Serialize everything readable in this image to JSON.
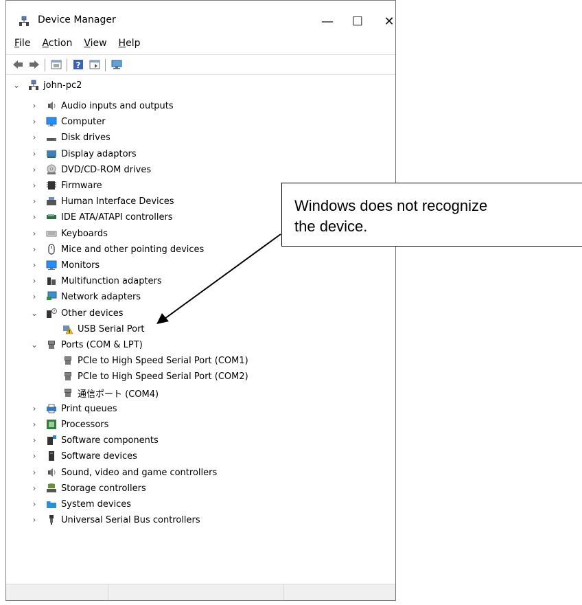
{
  "window": {
    "title": "Device Manager",
    "minimize": "—",
    "maximize": "☐",
    "close": "✕"
  },
  "menu": [
    {
      "underline": "F",
      "rest": "ile"
    },
    {
      "underline": "A",
      "rest": "ction"
    },
    {
      "underline": "V",
      "rest": "iew"
    },
    {
      "underline": "H",
      "rest": "elp"
    }
  ],
  "tree": {
    "root": "john-pc2",
    "categories": [
      {
        "label": "Audio inputs and outputs",
        "icon": "speaker-icon"
      },
      {
        "label": "Computer",
        "icon": "monitor-icon"
      },
      {
        "label": "Disk drives",
        "icon": "disk-icon"
      },
      {
        "label": "Display adaptors",
        "icon": "display-adapter-icon"
      },
      {
        "label": "DVD/CD-ROM drives",
        "icon": "dvd-icon"
      },
      {
        "label": "Firmware",
        "icon": "chip-icon"
      },
      {
        "label": "Human Interface Devices",
        "icon": "hid-icon"
      },
      {
        "label": "IDE ATA/ATAPI controllers",
        "icon": "controller-icon"
      },
      {
        "label": "Keyboards",
        "icon": "keyboard-icon"
      },
      {
        "label": "Mice and other pointing devices",
        "icon": "mouse-icon"
      },
      {
        "label": "Monitors",
        "icon": "monitor-icon"
      },
      {
        "label": "Multifunction adapters",
        "icon": "multifunction-icon"
      },
      {
        "label": "Network adapters",
        "icon": "network-icon"
      },
      {
        "label": "Other devices",
        "icon": "unknown-device-icon",
        "expanded": true
      },
      {
        "label": "USB Serial Port",
        "icon": "warning-device-icon",
        "child": true
      },
      {
        "label": "Ports (COM & LPT)",
        "icon": "port-icon",
        "expanded": true
      },
      {
        "label": "PCIe to High Speed Serial Port (COM1)",
        "icon": "port-icon",
        "child": true
      },
      {
        "label": "PCIe to High Speed Serial Port (COM2)",
        "icon": "port-icon",
        "child": true
      },
      {
        "label": "通信ポート (COM4)",
        "icon": "port-icon",
        "child": true
      },
      {
        "label": "Print queues",
        "icon": "printer-icon"
      },
      {
        "label": "Processors",
        "icon": "processor-icon"
      },
      {
        "label": "Software components",
        "icon": "software-component-icon"
      },
      {
        "label": "Software devices",
        "icon": "software-device-icon"
      },
      {
        "label": "Sound, video and game controllers",
        "icon": "speaker-icon"
      },
      {
        "label": "Storage controllers",
        "icon": "storage-icon"
      },
      {
        "label": "System devices",
        "icon": "folder-icon"
      },
      {
        "label": "Universal Serial Bus controllers",
        "icon": "usb-icon"
      }
    ]
  },
  "callout": {
    "text": "Windows does not recognize\nthe device."
  }
}
